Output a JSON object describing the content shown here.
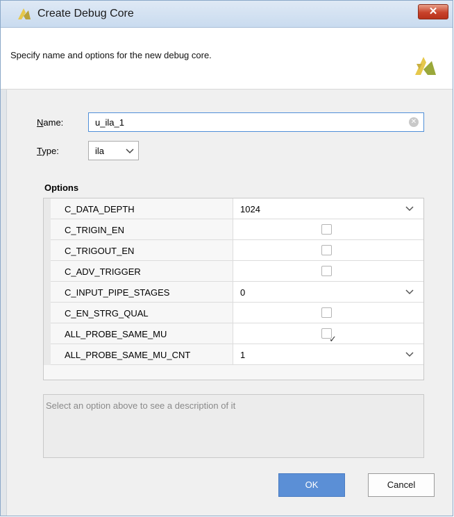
{
  "window": {
    "title": "Create Debug Core",
    "close_label": "✕"
  },
  "header": {
    "description": "Specify name and options for the new debug core."
  },
  "form": {
    "name_label_u": "N",
    "name_label_rest": "ame:",
    "name_value": "u_ila_1",
    "type_label_u": "T",
    "type_label_rest": "ype:",
    "type_value": "ila"
  },
  "options": {
    "title": "Options",
    "rows": [
      {
        "name": "C_DATA_DEPTH",
        "kind": "dropdown",
        "value": "1024"
      },
      {
        "name": "C_TRIGIN_EN",
        "kind": "checkbox",
        "checked": false
      },
      {
        "name": "C_TRIGOUT_EN",
        "kind": "checkbox",
        "checked": false
      },
      {
        "name": "C_ADV_TRIGGER",
        "kind": "checkbox",
        "checked": false
      },
      {
        "name": "C_INPUT_PIPE_STAGES",
        "kind": "dropdown",
        "value": "0"
      },
      {
        "name": "C_EN_STRG_QUAL",
        "kind": "checkbox",
        "checked": false
      },
      {
        "name": "ALL_PROBE_SAME_MU",
        "kind": "checkbox",
        "checked": true
      },
      {
        "name": "ALL_PROBE_SAME_MU_CNT",
        "kind": "dropdown",
        "value": "1"
      }
    ]
  },
  "description_box": {
    "placeholder": "Select an option above to see a description of it"
  },
  "buttons": {
    "ok": "OK",
    "cancel": "Cancel"
  },
  "colors": {
    "ok_button": "#5b8fd6",
    "close_button": "#c8432b",
    "logo": "#d6b94a"
  },
  "icons": {
    "title_logo": "vivado-logo-icon",
    "header_logo": "vivado-logo-icon",
    "clear": "clear-circle-icon",
    "dropdown": "chevron-down-icon",
    "check": "checkmark-icon"
  }
}
